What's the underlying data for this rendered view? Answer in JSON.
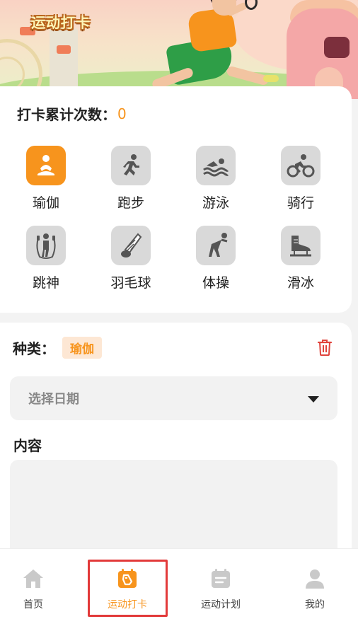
{
  "banner": {
    "title": "运动打卡"
  },
  "checkin": {
    "count_label": "打卡累计次数：",
    "count_value": "0"
  },
  "sports": [
    {
      "label": "瑜伽",
      "icon": "yoga-icon",
      "active": true
    },
    {
      "label": "跑步",
      "icon": "running-icon",
      "active": false
    },
    {
      "label": "游泳",
      "icon": "swimming-icon",
      "active": false
    },
    {
      "label": "骑行",
      "icon": "cycling-icon",
      "active": false
    },
    {
      "label": "跳神",
      "icon": "jump-rope-icon",
      "active": false
    },
    {
      "label": "羽毛球",
      "icon": "badminton-icon",
      "active": false
    },
    {
      "label": "体操",
      "icon": "gymnastics-icon",
      "active": false
    },
    {
      "label": "滑冰",
      "icon": "skating-icon",
      "active": false
    }
  ],
  "form": {
    "type_label": "种类：",
    "type_value": "瑜伽",
    "date_placeholder": "选择日期",
    "content_label": "内容",
    "content_value": ""
  },
  "tabs": [
    {
      "label": "首页",
      "icon": "home-icon",
      "active": false
    },
    {
      "label": "运动打卡",
      "icon": "sport-checkin-icon",
      "active": true
    },
    {
      "label": "运动计划",
      "icon": "calendar-plan-icon",
      "active": false
    },
    {
      "label": "我的",
      "icon": "user-icon",
      "active": false
    }
  ],
  "colors": {
    "accent": "#f7941d",
    "inactive_icon_bg": "#d9d9d9",
    "highlight": "#e23a3a"
  }
}
